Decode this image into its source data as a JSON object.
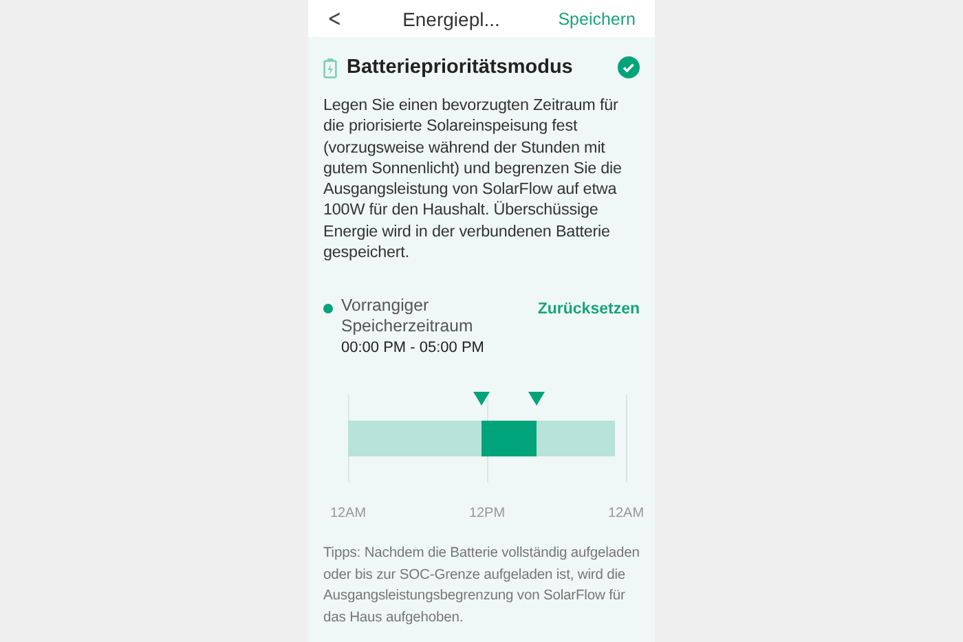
{
  "header": {
    "back": "<",
    "title": "Energiepl...",
    "action": "Speichern"
  },
  "mode": {
    "title": "Batterieprioritätsmodus",
    "checked": true,
    "description": "Legen Sie einen bevorzugten Zeitraum für die priorisierte Solareinspeisung fest (vorzugsweise während der Stunden mit gutem Sonnenlicht) und begrenzen Sie die Ausgangsleistung von SolarFlow auf etwa 100W für den Haushalt. Überschüssige Energie wird in der verbundenen Batterie gespeichert."
  },
  "period": {
    "label": "Vorrangiger Speicherzeitraum",
    "color": "#00a37a",
    "time": "00:00 PM - 05:00 PM",
    "reset": "Zurücksetzen"
  },
  "timeline": {
    "handles": [
      {
        "level": 0.5
      },
      {
        "level": 0.708
      }
    ],
    "axis_labels": [
      "12AM",
      "12PM",
      "12AM"
    ]
  },
  "tips": "Tipps: Nachdem die Batterie vollständig aufgeladen oder bis zur SOC-Grenze aufgeladen ist, wird die Ausgangsleistungsbegrenzung von SolarFlow für das Haus aufgehoben."
}
